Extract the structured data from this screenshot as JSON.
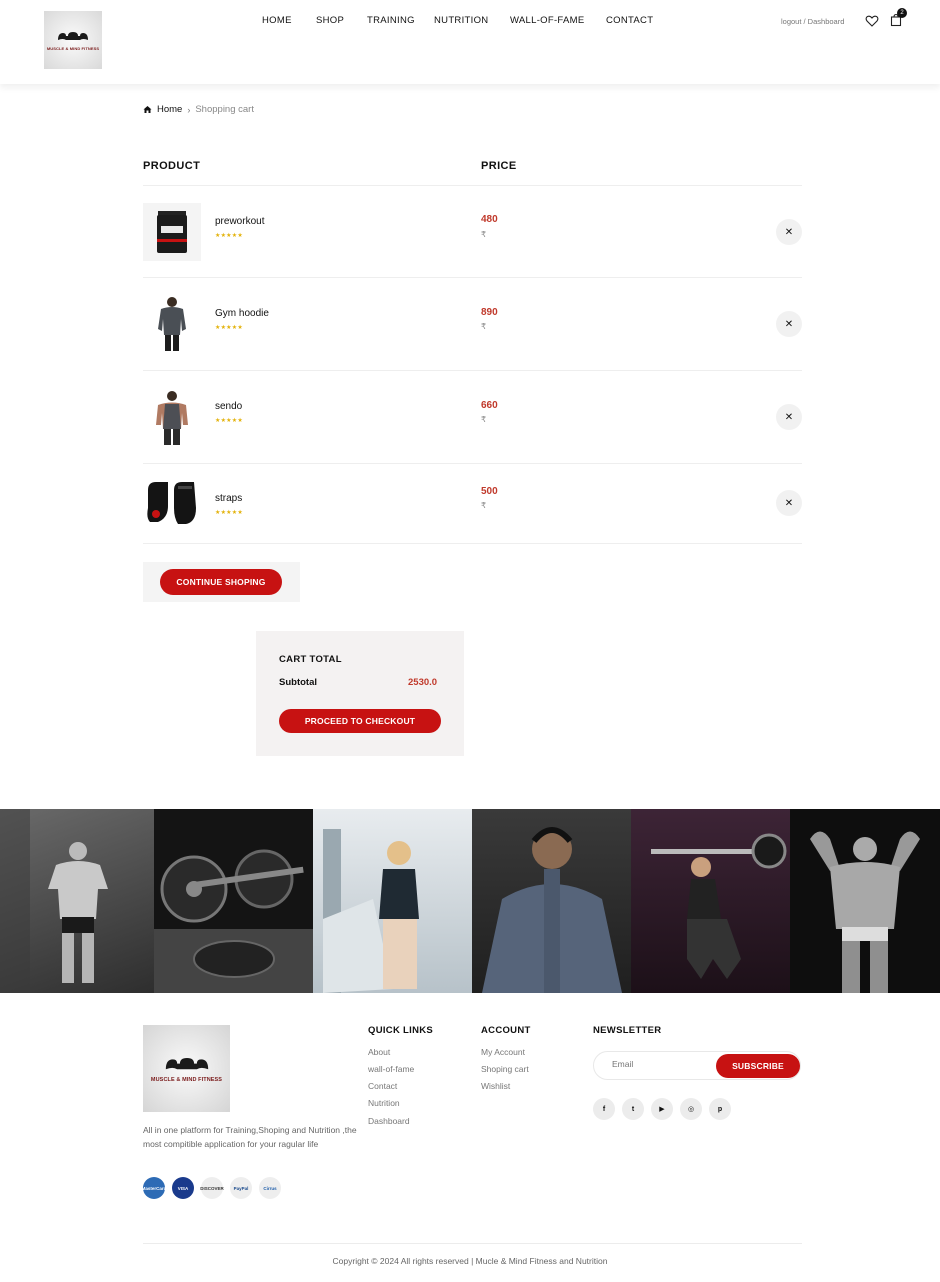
{
  "header": {
    "logo_text": "MUSCLE & MIND FITNESS",
    "nav": [
      "HOME",
      "SHOP",
      "TRAINING",
      "NUTRITION",
      "WALL-OF-FAME",
      "CONTACT"
    ],
    "account_links": "logout / Dashboard",
    "cart_count": "2"
  },
  "breadcrumb": {
    "home": "Home",
    "current": "Shopping cart"
  },
  "cart": {
    "col_product": "PRODUCT",
    "col_price": "PRICE",
    "stars": "★★★★★",
    "currency_symbol": "₹",
    "remove_symbol": "✕",
    "items": [
      {
        "name": "preworkout",
        "price": "480"
      },
      {
        "name": "Gym hoodie",
        "price": "890"
      },
      {
        "name": "sendo",
        "price": "660"
      },
      {
        "name": "straps",
        "price": "500"
      }
    ],
    "continue_label": "CONTINUE SHOPING"
  },
  "cart_total": {
    "title": "CART TOTAL",
    "subtotal_label": "Subtotal",
    "subtotal_value": "2530.0",
    "checkout_label": "PROCEED TO CHECKOUT"
  },
  "footer": {
    "logo_text": "MUSCLE & MIND FITNESS",
    "description": "All in one platform for Training,Shoping and Nutrition ,the most compitible application for your ragular life",
    "payments": [
      "MasterCard",
      "VISA",
      "DISCOVER",
      "PayPal",
      "Cirrus"
    ],
    "quick_links_title": "QUICK LINKS",
    "quick_links": [
      "About",
      "wall-of-fame",
      "Contact",
      "Nutrition",
      "Dashboard"
    ],
    "account_title": "ACCOUNT",
    "account_links": [
      "My Account",
      "Shoping cart",
      "Wishlist"
    ],
    "newsletter_title": "NEWSLETTER",
    "email_placeholder": "Email",
    "subscribe_label": "SUBSCRIBE",
    "socials": [
      "f",
      "t",
      "▶",
      "◎",
      "p"
    ],
    "copyright": "Copyright © 2024 All rights reserved | Mucle & Mind Fitness and Nutrition"
  },
  "colors": {
    "accent": "#c71212",
    "price": "#c0392b",
    "stars": "#e3b20b"
  }
}
